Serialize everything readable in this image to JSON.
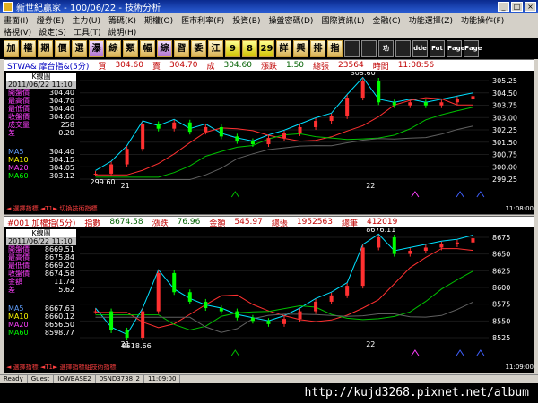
{
  "window": {
    "title": "新世紀贏家 - 100/06/22 - 技術分析",
    "controls": [
      "_",
      "□",
      "×"
    ]
  },
  "menu1": [
    "畫面(I)",
    "證券(E)",
    "主力(U)",
    "籌碼(K)",
    "期權(O)",
    "匯市利率(F)",
    "投資(B)",
    "操盤密碼(D)",
    "國際資訊(L)",
    "金融(C)",
    "功能選擇(Z)",
    "功能操作(F)"
  ],
  "menu2": [
    "格視(V)",
    "設定(S)",
    "工具(T)",
    "說明(H)"
  ],
  "toolbar": [
    "加",
    "權",
    "期",
    "價",
    "選",
    "瀑",
    "綜",
    "類",
    "幅",
    "綜",
    "習",
    "委",
    "江",
    "9",
    "8",
    "29",
    "詳",
    "興",
    "排",
    "指",
    "",
    "",
    "功",
    "",
    "dde",
    "Fut",
    "Page",
    "Page"
  ],
  "panel1": {
    "header": {
      "code": "STWA& 摩台指&(5分)",
      "buy_label": "買",
      "buy": "304.60",
      "sell_label": "賣",
      "sell": "304.70",
      "deal_label": "成",
      "deal": "304.60",
      "change_label": "漲跌",
      "change": "1.50",
      "vol_label": "總張",
      "vol": "23564",
      "time_label": "時間",
      "time": "11:08:56"
    },
    "info": {
      "title": "K線圖",
      "date": "2011/06/22 11:10",
      "rows": [
        {
          "k": "開盤價",
          "v": "304.40"
        },
        {
          "k": "最高價",
          "v": "304.70"
        },
        {
          "k": "最低價",
          "v": "304.40"
        },
        {
          "k": "收盤價",
          "v": "304.60"
        },
        {
          "k": "成交量",
          "v": "258"
        },
        {
          "k": "差",
          "v": "0.20"
        }
      ],
      "ma": [
        {
          "k": "MA5",
          "v": "304.40",
          "color": "#ffffff"
        },
        {
          "k": "MA10",
          "v": "304.15",
          "color": "#ffffff"
        },
        {
          "k": "MA20",
          "v": "304.05",
          "color": "#ffffff"
        },
        {
          "k": "MA60",
          "v": "303.12",
          "color": "#ffffff"
        }
      ]
    },
    "yticks": [
      "305.25",
      "304.50",
      "303.75",
      "303.00",
      "302.25",
      "301.50",
      "300.75",
      "300.00",
      "299.25"
    ],
    "labels": {
      "high": "305.60",
      "low": "299.60",
      "day1": "21",
      "day2": "22"
    },
    "foot": "◄ 選擇指標 ◄T1► 切換技術指標",
    "foot_time": "11:08:00"
  },
  "panel2": {
    "header": {
      "code": "#001 加權指(5分)",
      "index_label": "指數",
      "index": "8674.58",
      "change_label": "漲跌",
      "change": "76.96",
      "amount_label": "金額",
      "amount": "545.97",
      "vol_label": "總張",
      "vol": "1952563",
      "total_label": "總筆",
      "total": "412019"
    },
    "info": {
      "title": "K線圖",
      "date": "2011/06/22 11:10",
      "rows": [
        {
          "k": "開盤價",
          "v": "8669.51"
        },
        {
          "k": "最高價",
          "v": "8675.84"
        },
        {
          "k": "最低價",
          "v": "8669.20"
        },
        {
          "k": "收盤價",
          "v": "8674.58"
        },
        {
          "k": "金額",
          "v": "11.74"
        },
        {
          "k": "差",
          "v": "5.62"
        }
      ],
      "ma": [
        {
          "k": "MA5",
          "v": "8667.63"
        },
        {
          "k": "MA10",
          "v": "8660.12"
        },
        {
          "k": "MA20",
          "v": "8656.50"
        },
        {
          "k": "MA60",
          "v": "8598.77"
        }
      ]
    },
    "yticks": [
      "8675",
      "8650",
      "8625",
      "8600",
      "8575",
      "8550",
      "8525"
    ],
    "labels": {
      "high": "8676.11",
      "low": "8518.66",
      "day1": "21",
      "day2": "22"
    },
    "foot": "◄ 選擇指標 ◄T1► 選擇指標組技術指標",
    "foot_time": "11:09:00"
  },
  "status": [
    "Ready",
    "Guest",
    "IOWBASE2",
    "0SND3738_2",
    "11:09:00"
  ],
  "footer_url": "http://kujd3268.pixnet.net/album",
  "chart_data": [
    {
      "type": "line",
      "title": "STWA& 摩台指&(5分)",
      "ylim": [
        299.25,
        305.6
      ],
      "series": [
        {
          "values": [
            299.6,
            300.2,
            301.2,
            302.8,
            302.5,
            302.9,
            302.3,
            302.6,
            302.0,
            301.7,
            301.5,
            301.9,
            302.2,
            302.6,
            303.0,
            303.3,
            304.5,
            305.6,
            304.2,
            304.0,
            304.2,
            304.0,
            304.2,
            304.4,
            304.6
          ]
        }
      ]
    },
    {
      "type": "line",
      "title": "#001 加權指(5分)",
      "ylim": [
        8518.66,
        8676.11
      ],
      "series": [
        {
          "values": [
            8560,
            8530,
            8518.66,
            8560,
            8620,
            8590,
            8575,
            8565,
            8560,
            8550,
            8545,
            8540,
            8548,
            8560,
            8575,
            8585,
            8600,
            8660,
            8676.11,
            8650,
            8655,
            8660,
            8665,
            8668,
            8674.58
          ]
        }
      ]
    }
  ]
}
